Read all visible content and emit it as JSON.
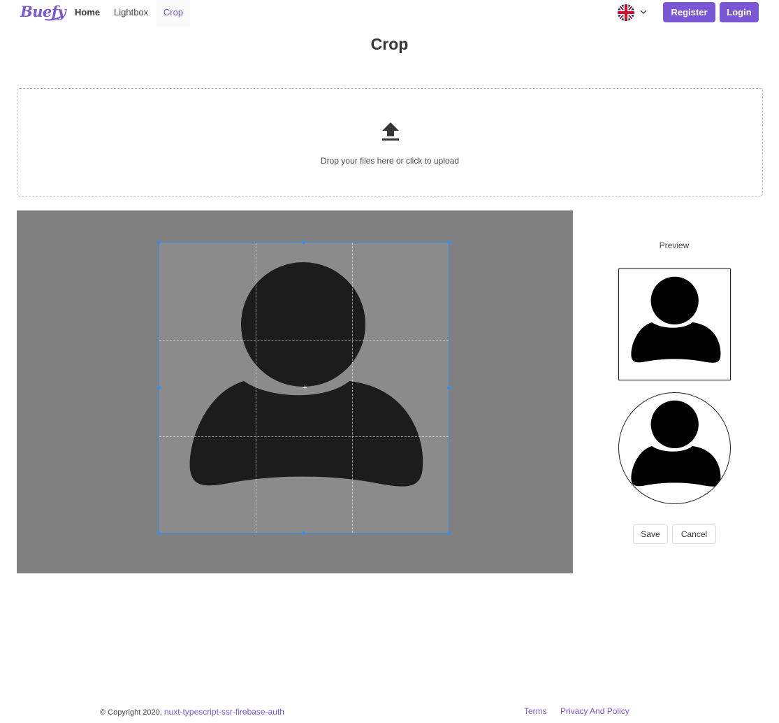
{
  "nav": {
    "brand": "Buefy",
    "items": [
      {
        "label": "Home"
      },
      {
        "label": "Lightbox"
      },
      {
        "label": "Crop"
      }
    ],
    "language_icon": "uk-flag-icon",
    "register_label": "Register",
    "login_label": "Login"
  },
  "page": {
    "title": "Crop"
  },
  "upload": {
    "icon": "upload-icon",
    "text": "Drop your files here or click to upload"
  },
  "preview": {
    "label": "Preview",
    "save_label": "Save",
    "cancel_label": "Cancel"
  },
  "footer": {
    "copyright": "© Copyright 2020,",
    "project_link": "nuxt-typescript-ssr-firebase-auth",
    "terms": "Terms",
    "privacy": "Privacy And Policy"
  },
  "colors": {
    "primary": "#7957d5",
    "crop_border": "#3a8ee6",
    "cropper_bg": "#808080"
  }
}
